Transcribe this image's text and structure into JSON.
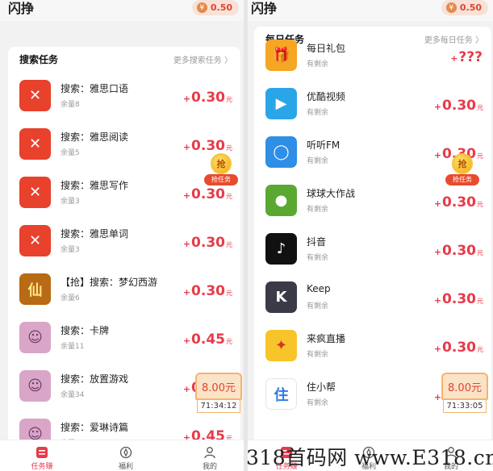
{
  "app": {
    "title": "闪挣",
    "coin_value": "0.50",
    "coin_symbol": "¥"
  },
  "left": {
    "section_title": "搜索任务",
    "more_label": "更多搜索任务 〉",
    "items": [
      {
        "name": "搜索：雅思口语",
        "sub": "余量8",
        "plus": "+",
        "amount": "0.30",
        "unit": "元",
        "icon": "ielts-app-icon",
        "icon_color": "#e8412c"
      },
      {
        "name": "搜索：雅思阅读",
        "sub": "余量5",
        "plus": "+",
        "amount": "0.30",
        "unit": "元",
        "icon": "ielts-app-icon",
        "icon_color": "#e8412c"
      },
      {
        "name": "搜索：雅思写作",
        "sub": "余量3",
        "plus": "+",
        "amount": "0.30",
        "unit": "元",
        "icon": "ielts-app-icon",
        "icon_color": "#e8412c"
      },
      {
        "name": "搜索：雅思单词",
        "sub": "余量3",
        "plus": "+",
        "amount": "0.30",
        "unit": "元",
        "icon": "ielts-app-icon",
        "icon_color": "#e8412c"
      },
      {
        "name": "【抢】搜索：梦幻西游",
        "sub": "余量6",
        "plus": "+",
        "amount": "0.30",
        "unit": "元",
        "icon": "game-app-icon",
        "icon_color": "#c8781e"
      },
      {
        "name": "搜索：卡牌",
        "sub": "余量11",
        "plus": "+",
        "amount": "0.45",
        "unit": "元",
        "icon": "anime-girl-icon",
        "icon_color": "#d9a6c8"
      },
      {
        "name": "搜索：放置游戏",
        "sub": "余量34",
        "plus": "+",
        "amount": "0.30",
        "unit": "元",
        "icon": "anime-girl-icon",
        "icon_color": "#d9a6c8"
      },
      {
        "name": "搜索：爱琳诗篇",
        "sub": "余量20",
        "plus": "+",
        "amount": "0.45",
        "unit": "元",
        "icon": "anime-girl-icon",
        "icon_color": "#d9a6c8"
      }
    ],
    "grab_label": "抢任务",
    "grab_char": "抢",
    "redpacket_amount": "8.00元",
    "redpacket_timer": "71:34:12"
  },
  "right": {
    "section_title": "每日任务",
    "more_label": "更多每日任务 〉",
    "items": [
      {
        "name": "每日礼包",
        "sub": "有剩余",
        "plus": "+",
        "amount": "???",
        "unit": "",
        "icon": "gift-icon",
        "icon_color": "#f5a623"
      },
      {
        "name": "优酷视频",
        "sub": "有剩余",
        "plus": "+",
        "amount": "0.30",
        "unit": "元",
        "icon": "youku-icon",
        "icon_color": "#2aa6e8"
      },
      {
        "name": "听听FM",
        "sub": "有剩余",
        "plus": "+",
        "amount": "0.30",
        "unit": "元",
        "icon": "tingting-fm-icon",
        "icon_color": "#2f8ee6"
      },
      {
        "name": "球球大作战",
        "sub": "有剩余",
        "plus": "+",
        "amount": "0.30",
        "unit": "元",
        "icon": "ball-game-icon",
        "icon_color": "#5aa832"
      },
      {
        "name": "抖音",
        "sub": "有剩余",
        "plus": "+",
        "amount": "0.30",
        "unit": "元",
        "icon": "douyin-icon",
        "icon_color": "#111111"
      },
      {
        "name": "Keep",
        "sub": "有剩余",
        "plus": "+",
        "amount": "0.30",
        "unit": "元",
        "icon": "keep-icon",
        "icon_color": "#3a3a48"
      },
      {
        "name": "来疯直播",
        "sub": "有剩余",
        "plus": "+",
        "amount": "0.30",
        "unit": "元",
        "icon": "laifeng-icon",
        "icon_color": "#f7c52a"
      },
      {
        "name": "住小帮",
        "sub": "有剩余",
        "plus": "+",
        "amount": "0.30",
        "unit": "元",
        "icon": "zhuxiaobang-icon",
        "icon_color": "#2f7de0"
      }
    ],
    "grab_label": "抢任务",
    "grab_char": "抢",
    "redpacket_amount": "8.00元",
    "redpacket_timer": "71:33:05"
  },
  "tabs": [
    {
      "label": "任务赚",
      "icon": "task-icon"
    },
    {
      "label": "福利",
      "icon": "welfare-icon"
    },
    {
      "label": "我的",
      "icon": "profile-icon"
    }
  ],
  "watermark": "318首码网 www.E318.cn",
  "colors": {
    "accent": "#e83a4a",
    "card_bg": "#ffffff",
    "page_bg": "#f2f2f2"
  }
}
